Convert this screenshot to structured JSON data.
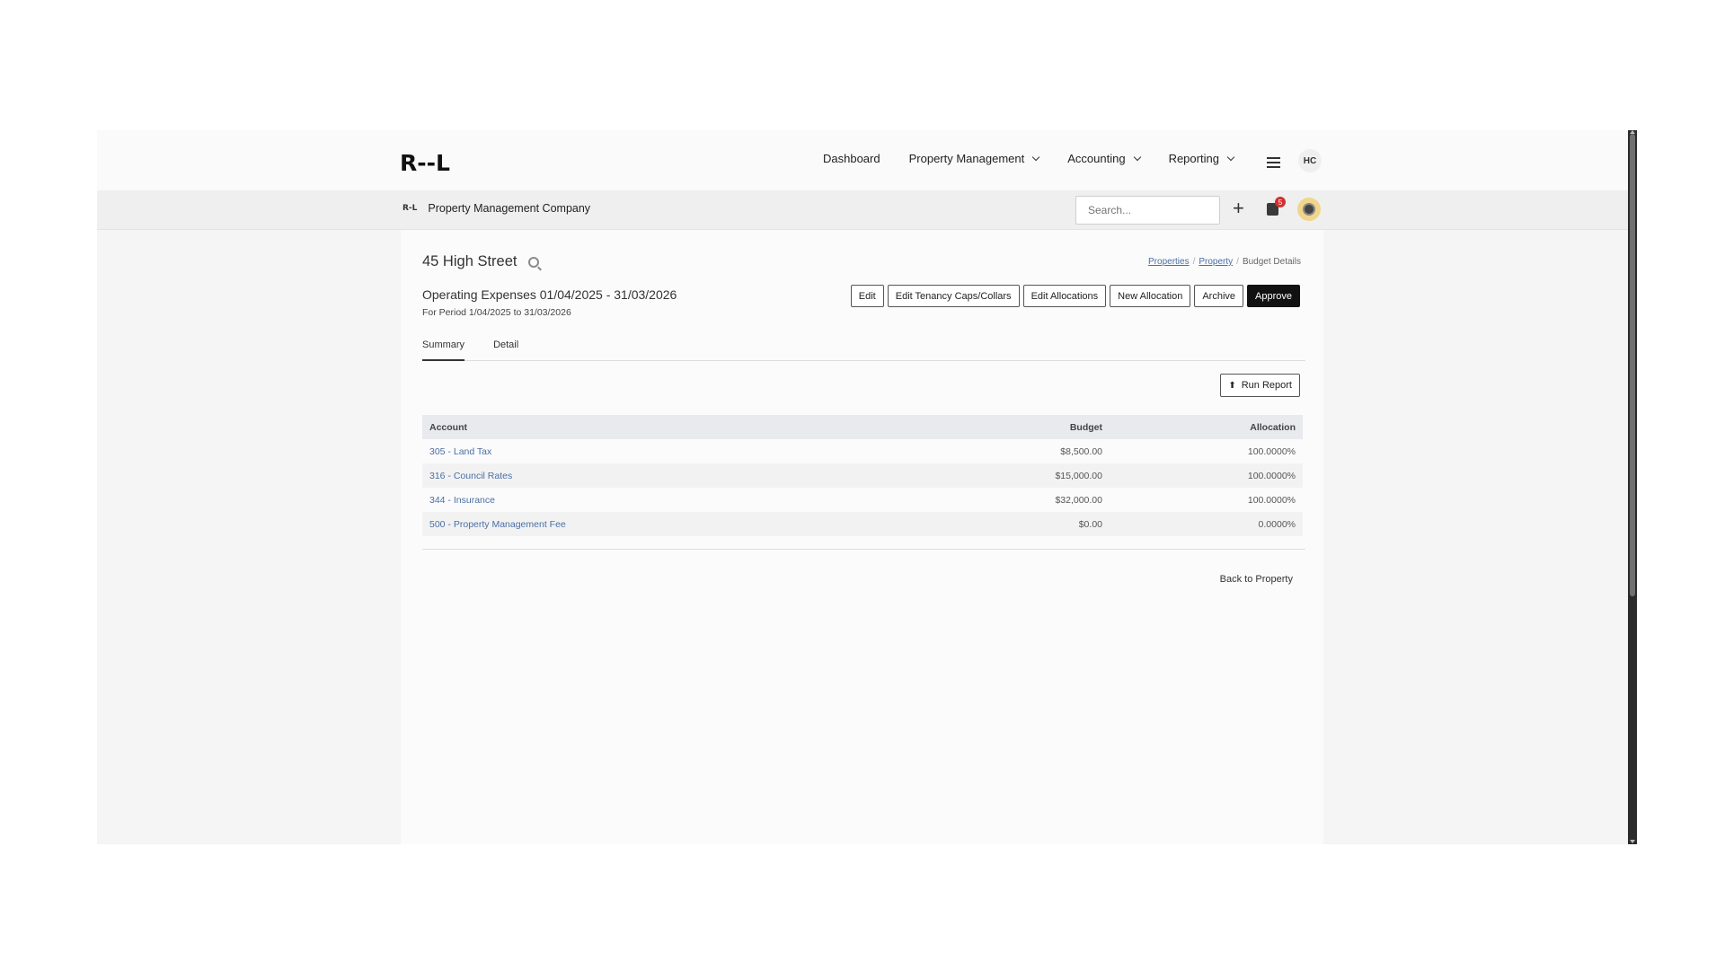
{
  "nav": {
    "logo": "R--L",
    "items": [
      {
        "label": "Dashboard",
        "dropdown": false
      },
      {
        "label": "Property Management",
        "dropdown": true
      },
      {
        "label": "Accounting",
        "dropdown": true
      },
      {
        "label": "Reporting",
        "dropdown": true
      }
    ],
    "user_initials": "HC"
  },
  "subbar": {
    "mini_logo": "R-L",
    "company": "Property Management Company",
    "search_placeholder": "Search...",
    "notification_count": "5"
  },
  "page": {
    "title": "45 High Street",
    "breadcrumb": [
      "Properties",
      "Property",
      "Budget Details"
    ],
    "subtitle": "Operating Expenses 01/04/2025 - 31/03/2026",
    "period": "For Period 1/04/2025 to 31/03/2026",
    "actions": [
      "Edit",
      "Edit Tenancy Caps/Collars",
      "Edit Allocations",
      "New Allocation",
      "Archive",
      "Approve"
    ],
    "tabs": [
      "Summary",
      "Detail"
    ],
    "run_report": "Run Report",
    "back_link": "Back to Property"
  },
  "table": {
    "headers": [
      "Account",
      "Budget",
      "Allocation"
    ],
    "rows": [
      [
        "305 - Land Tax",
        "$8,500.00",
        "100.0000%"
      ],
      [
        "316 - Council Rates",
        "$15,000.00",
        "100.0000%"
      ],
      [
        "344 - Insurance",
        "$32,000.00",
        "100.0000%"
      ],
      [
        "500 - Property Management Fee",
        "$0.00",
        "0.0000%"
      ]
    ]
  }
}
